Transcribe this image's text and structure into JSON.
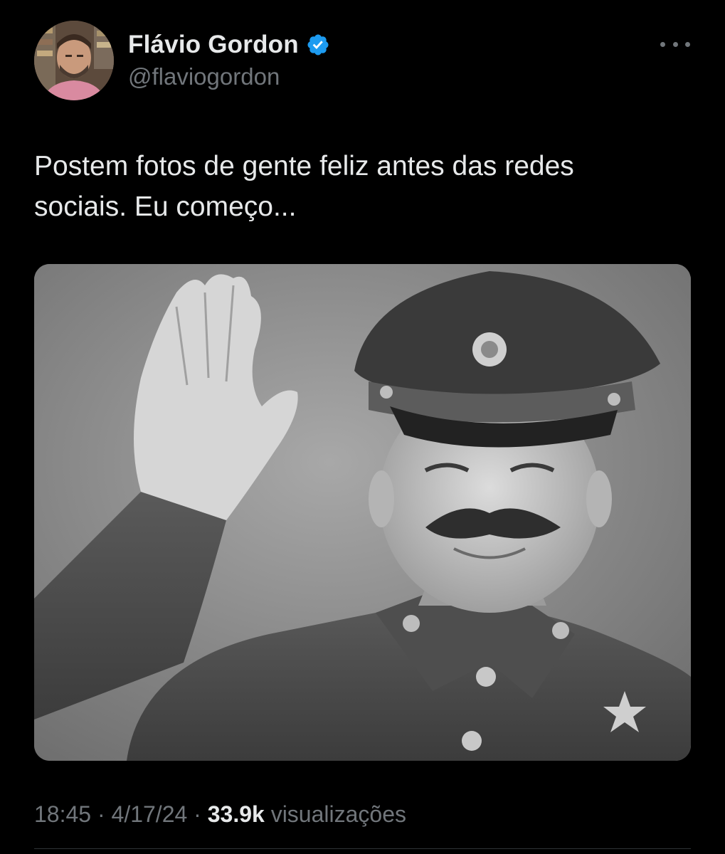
{
  "author": {
    "display_name": "Flávio Gordon",
    "handle": "@flaviogordon",
    "verified": true,
    "verified_icon": "verified-badge-icon",
    "verified_color": "#1d9bf0"
  },
  "tweet": {
    "text": "Postem fotos de gente feliz antes das redes sociais. Eu começo...",
    "media_alt": "black-and-white photo of a smiling man in military uniform and cap waving his hand"
  },
  "meta": {
    "time": "18:45",
    "separator": "·",
    "date": "4/17/24",
    "views_count": "33.9k",
    "views_label": "visualizações"
  },
  "menu": {
    "icon": "more-options-icon"
  },
  "colors": {
    "background": "#000000",
    "primary_text": "#e7e9ea",
    "secondary_text": "#71767b",
    "accent": "#1d9bf0"
  }
}
